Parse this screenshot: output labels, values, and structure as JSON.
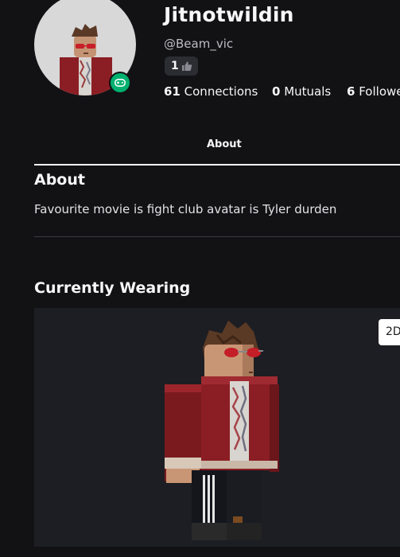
{
  "profile": {
    "display_name": "Jitnotwildin",
    "username": "@Beam_vic",
    "badge_count": "1",
    "presence_icon": "gamepad-icon",
    "stats": {
      "connections_count": "61",
      "connections_label": "Connections",
      "mutuals_count": "0",
      "mutuals_label": "Mutuals",
      "followers_count": "6",
      "followers_label": "Followers"
    }
  },
  "tabs": [
    {
      "label": "About"
    }
  ],
  "about": {
    "title": "About",
    "text": "Favourite movie is fight club avatar is Tyler durden"
  },
  "wearing": {
    "title": "Currently Wearing",
    "view_toggle": "2D"
  },
  "colors": {
    "background": "#121215",
    "presence": "#00b06f",
    "jacket": "#8b1e24",
    "viewer_bg": "#1d1e23"
  }
}
